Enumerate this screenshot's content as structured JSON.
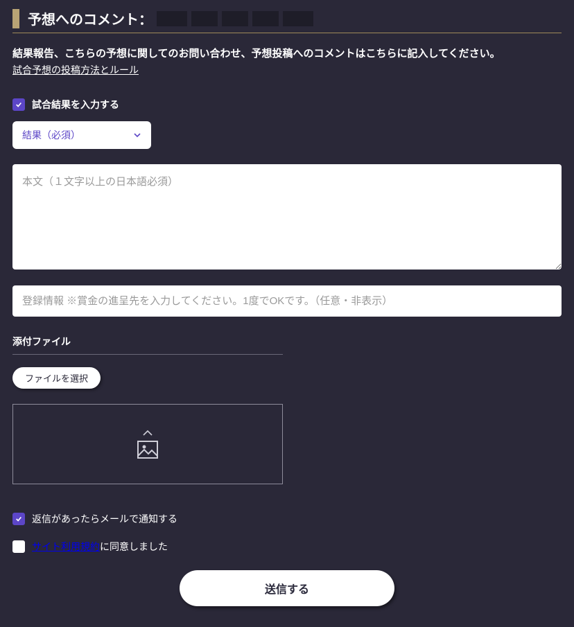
{
  "title": "予想へのコメント：",
  "intro_text": "結果報告、こちらの予想に関してのお問い合わせ、予想投稿へのコメントはこちらに記入してください。",
  "intro_link": "試合予想の投稿方法とルール",
  "checkbox_enter_result": {
    "label": "試合結果を入力する",
    "checked": true
  },
  "result_select": {
    "placeholder": "結果（必須）"
  },
  "body_textarea": {
    "placeholder": "本文（１文字以上の日本語必須）"
  },
  "reg_info_input": {
    "placeholder": "登録情報 ※賞金の進呈先を入力してください。1度でOKです。（任意・非表示）"
  },
  "attach_section_title": "添付ファイル",
  "file_button": "ファイルを選択",
  "checkbox_notify": {
    "label": "返信があったらメールで通知する",
    "checked": true
  },
  "checkbox_tos": {
    "label_link": "サイト利用規約",
    "label_rest": "に同意しました",
    "checked": false
  },
  "submit_button": "送信する"
}
